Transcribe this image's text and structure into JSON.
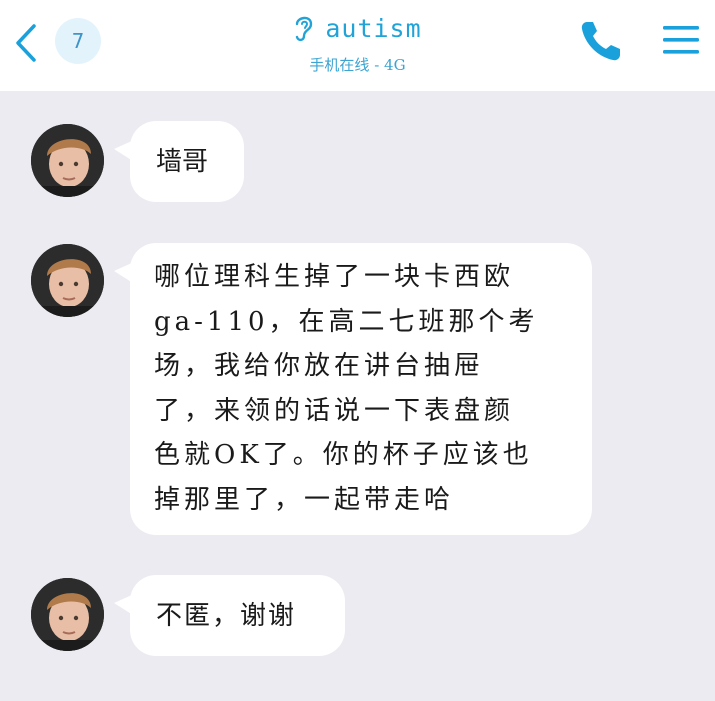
{
  "header": {
    "badge_count": "7",
    "title": "autism",
    "status": "手机在线 - 4G",
    "icons": {
      "back": "chevron-left-icon",
      "contact": "ear-icon",
      "call": "phone-icon",
      "menu": "hamburger-menu-icon"
    },
    "accent_color": "#21a3d8"
  },
  "messages": [
    {
      "text": "墙哥"
    },
    {
      "text": "哪位理科生掉了一块卡西欧\nga-110，在高二七班那个考\n场，我给你放在讲台抽屉\n了，来领的话说一下表盘颜\n色就OK了。你的杯子应该也\n掉那里了，一起带走哈"
    },
    {
      "text": "不匿，谢谢"
    }
  ],
  "colors": {
    "background": "#ebebf1",
    "bubble": "#ffffff",
    "header": "#ffffff"
  }
}
